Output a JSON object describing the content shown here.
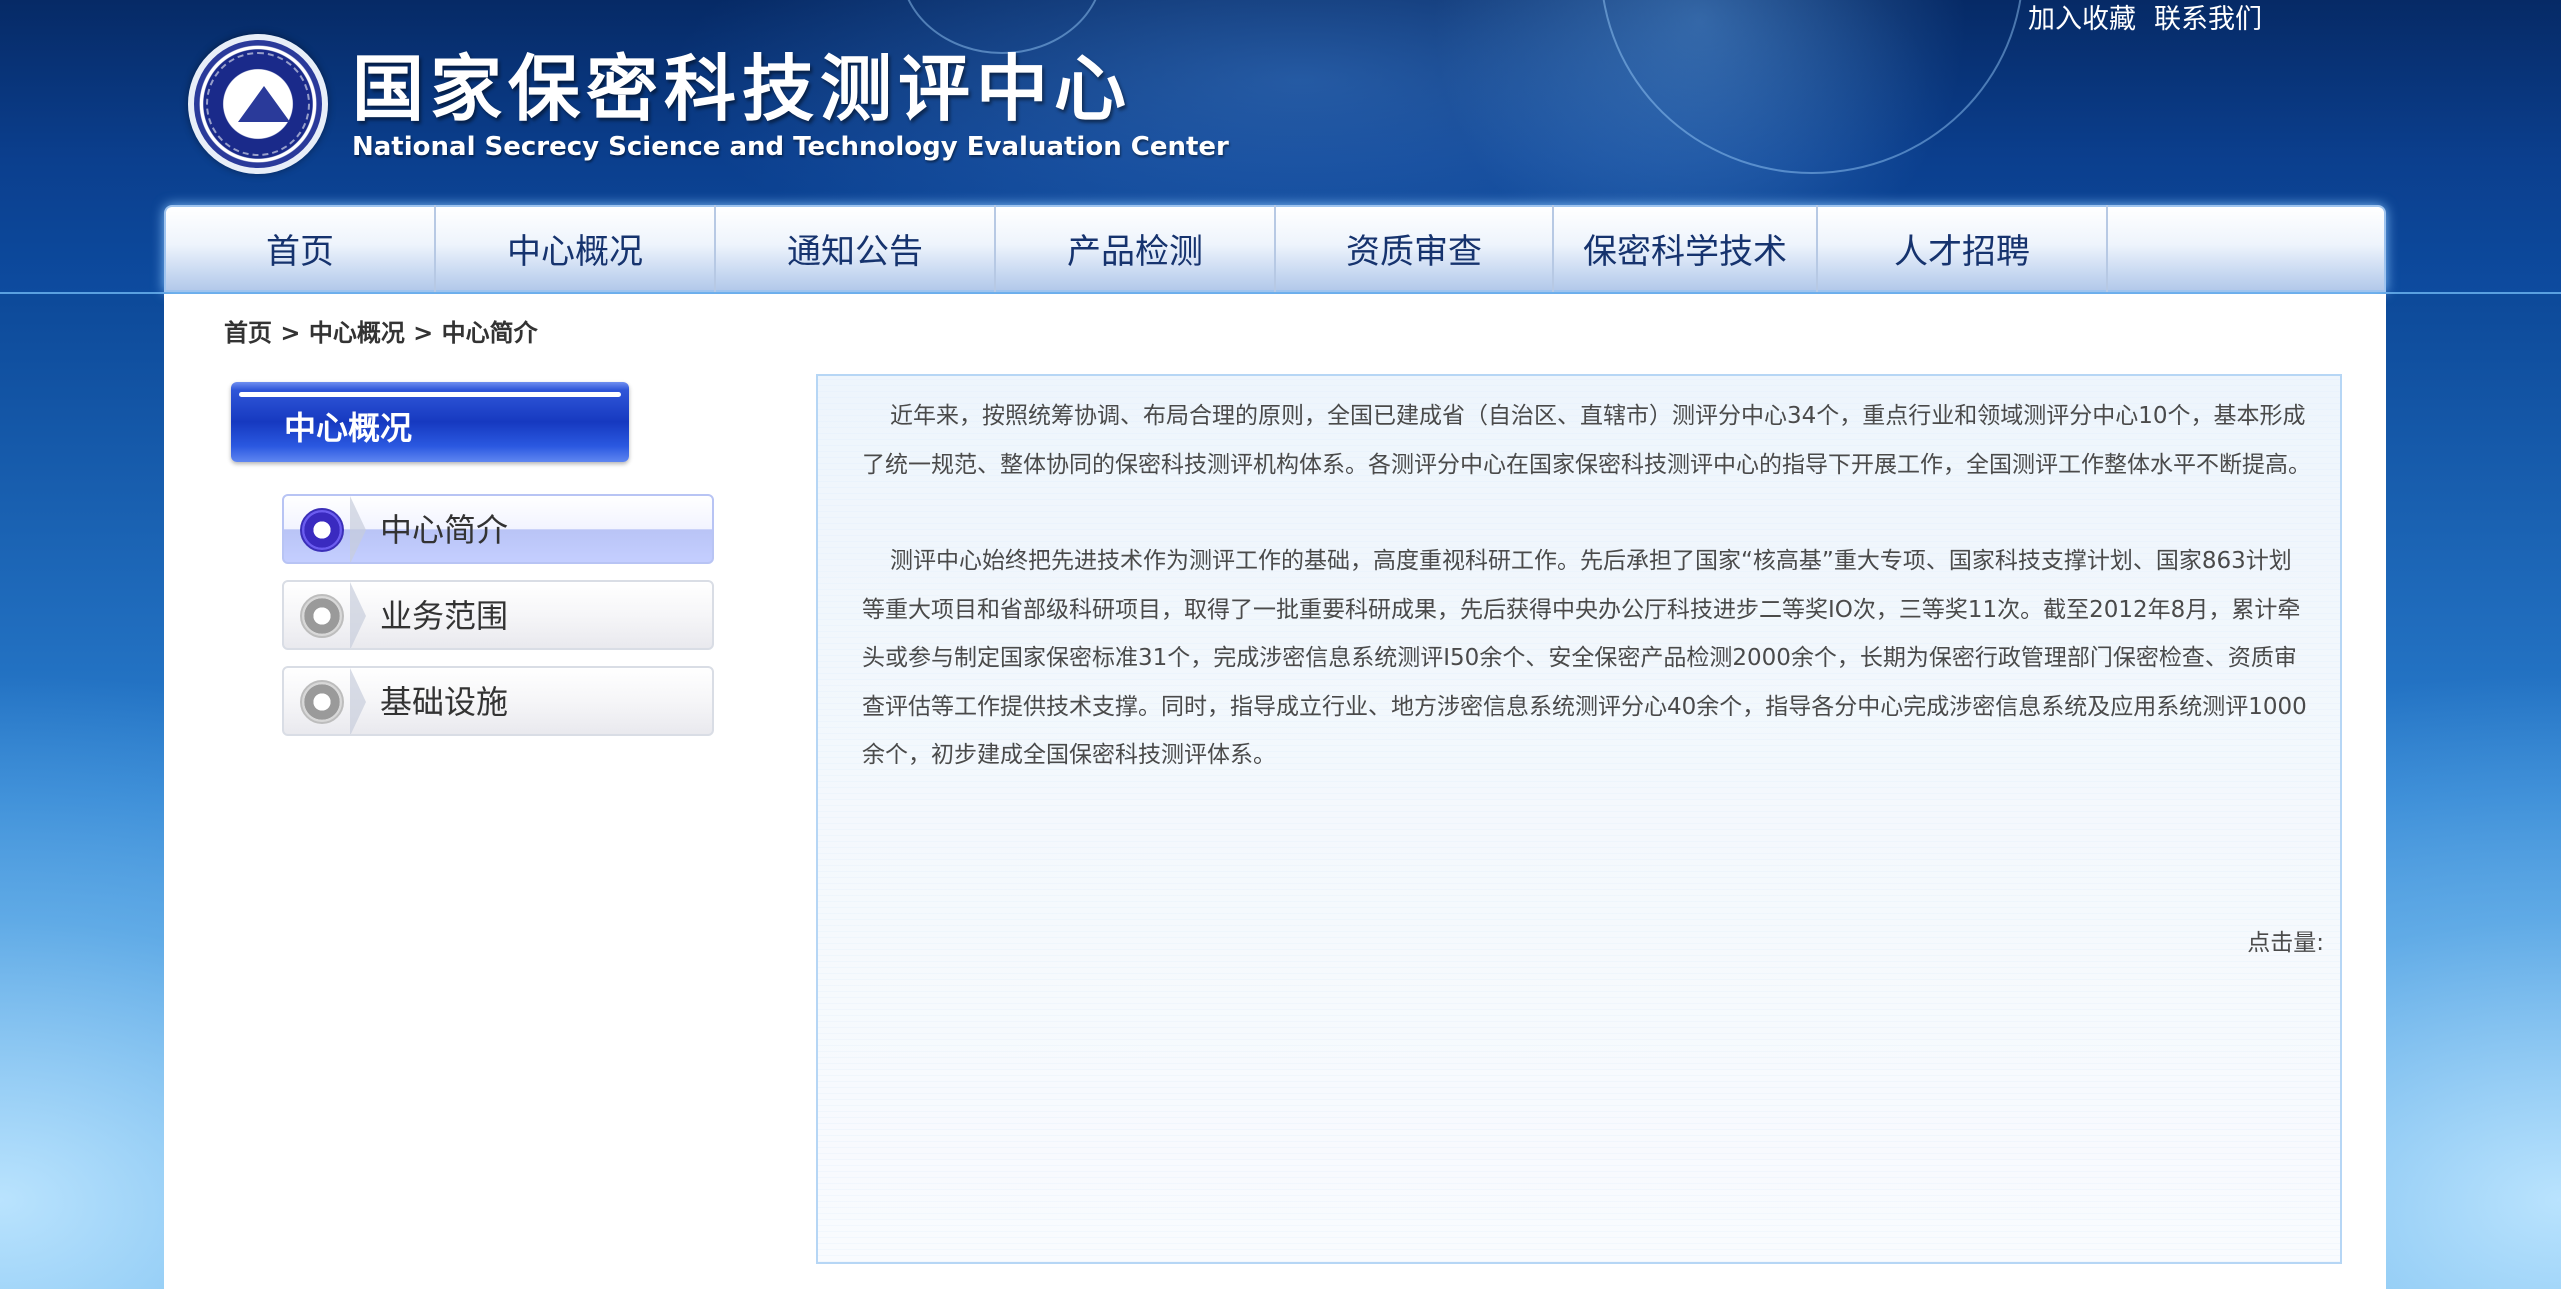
{
  "header": {
    "title": "国家保密科技测评中心",
    "subtitle": "National Secrecy Science and Technology Evaluation Center",
    "top_links": [
      "加入收藏",
      "联系我们"
    ]
  },
  "nav": {
    "items": [
      "首页",
      "中心概况",
      "通知公告",
      "产品检测",
      "资质审查",
      "保密科学技术",
      "人才招聘"
    ]
  },
  "breadcrumb": {
    "home": "首页",
    "sep": " > ",
    "section": "中心概况",
    "current": "中心简介"
  },
  "sidebar": {
    "title": "中心概况",
    "items": [
      {
        "label": "中心简介",
        "active": true
      },
      {
        "label": "业务范围",
        "active": false
      },
      {
        "label": "基础设施",
        "active": false
      }
    ]
  },
  "article": {
    "paragraphs": [
      "近年来，按照统筹协调、布局合理的原则，全国已建成省（自治区、直辖市）测评分中心34个，重点行业和领域测评分中心10个，基本形成了统一规范、整体协同的保密科技测评机构体系。各测评分中心在国家保密科技测评中心的指导下开展工作，全国测评工作整体水平不断提高。",
      "测评中心始终把先进技术作为测评工作的基础，高度重视科研工作。先后承担了国家“核高基”重大专项、国家科技支撑计划、国家863计划等重大项目和省部级科研项目，取得了一批重要科研成果，先后获得中央办公厅科技进步二等奖IO次，三等奖11次。截至2012年8月，累计牵头或参与制定国家保密标准31个，完成涉密信息系统测评I50余个、安全保密产品检测2000余个，长期为保密行政管理部门保密检查、资质审查评估等工作提供技术支撑。同时，指导成立行业、地方涉密信息系统测评分心40余个，指导各分中心完成涉密信息系统及应用系统测评1000余个，初步建成全国保密科技测评体系。"
    ],
    "click_count_label": "点击量:"
  },
  "colors": {
    "header_bg": "#0b3f8e",
    "nav_text": "#16336e",
    "side_active": "#1639c0",
    "article_border": "#b6d6f5"
  }
}
